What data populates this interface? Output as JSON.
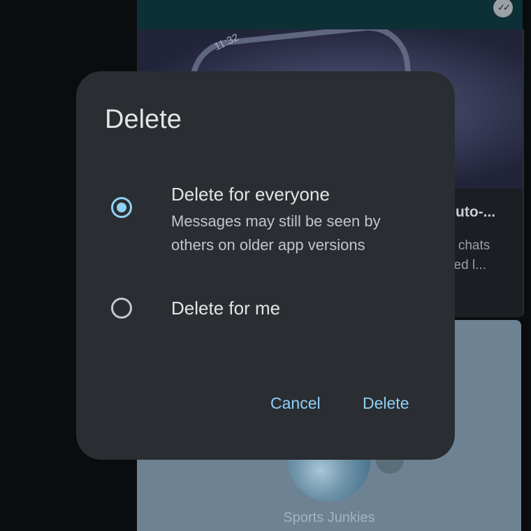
{
  "background_chat": {
    "preview_clock_text": "11:32",
    "card_title_fragment": "uto-...",
    "card_text_fragment": "o chats\nzed l...",
    "group_name": "Sports Junkies",
    "read_receipt_icon": "double-check-icon"
  },
  "dialog": {
    "title": "Delete",
    "options": [
      {
        "label": "Delete for everyone",
        "description": "Messages may still be seen by others on older app versions",
        "selected": true
      },
      {
        "label": "Delete for me",
        "selected": false
      }
    ],
    "buttons": {
      "cancel": "Cancel",
      "delete": "Delete"
    }
  },
  "colors": {
    "accent": "#8fd0f6",
    "dialog_surface": "#2a2d31",
    "text_primary": "#e3e4e6",
    "text_secondary": "#c2c5ca"
  }
}
